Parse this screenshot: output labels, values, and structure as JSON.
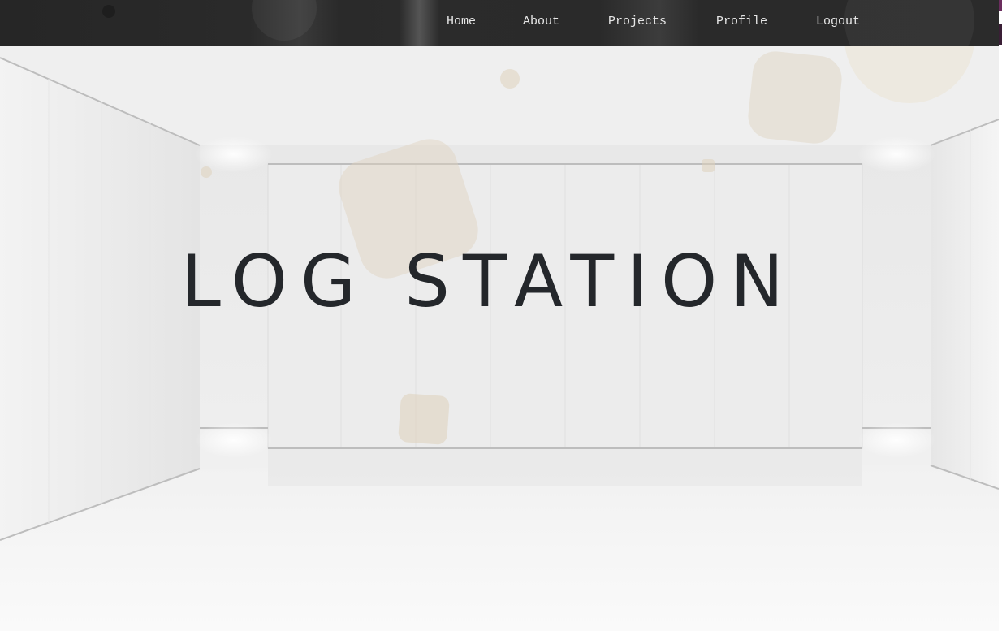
{
  "nav": {
    "items": [
      {
        "label": "Home"
      },
      {
        "label": "About"
      },
      {
        "label": "Projects"
      },
      {
        "label": "Profile"
      },
      {
        "label": "Logout"
      }
    ]
  },
  "hero": {
    "title": "LOG STATION"
  },
  "colors": {
    "navbar_bg": "#2b2b2b",
    "nav_text": "#e6e6e6",
    "title_text": "#24272b",
    "room_bg": "#ececec",
    "decor_beige": "#ded2bc"
  }
}
